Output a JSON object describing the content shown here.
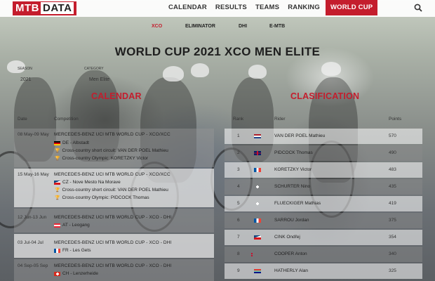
{
  "header": {
    "logo_mtb": "MTB",
    "logo_data": "DATA",
    "nav": [
      {
        "label": "CALENDAR"
      },
      {
        "label": "RESULTS"
      },
      {
        "label": "TEAMS"
      },
      {
        "label": "RANKING"
      },
      {
        "label": "WORLD CUP",
        "active": true
      }
    ],
    "search_icon": "search-icon"
  },
  "subnav": [
    {
      "label": "XCO",
      "active": true
    },
    {
      "label": "ELIMINATOR"
    },
    {
      "label": "DHI"
    },
    {
      "label": "E-MTB"
    }
  ],
  "page_title": "WORLD CUP 2021 XCO MEN ELITE",
  "filters": {
    "season_label": "SEASON",
    "season_value": "2021",
    "category_label": "CATEGORY",
    "category_value": "Men Elite"
  },
  "calendar": {
    "title": "CALENDAR",
    "col_date": "Date",
    "col_competition": "Competition",
    "rows": [
      {
        "date": "08 May-09 May",
        "competition": "MERCEDES-BENZ UCI MTB WORLD CUP - XCO/XCC",
        "location_flag": "DE",
        "location": "DE - Albstadt",
        "winners": [
          "Cross-country short circuit: VAN DER POEL Mathieu",
          "Cross-country Olympic: KORETZKY Victor"
        ]
      },
      {
        "date": "15 May-16 May",
        "competition": "MERCEDES-BENZ UCI MTB WORLD CUP - XCO/XCC",
        "location_flag": "CZ",
        "location": "CZ - Nove Mesto Na Morave",
        "winners": [
          "Cross-country short circuit: VAN DER POEL Mathieu",
          "Cross-country Olympic: PIDCOCK Thomas"
        ]
      },
      {
        "date": "12 Jun-13 Jun",
        "competition": "MERCEDES-BENZ UCI MTB WORLD CUP - XCO - DHI",
        "location_flag": "AT",
        "location": "AT - Leogang",
        "winners": []
      },
      {
        "date": "03 Jul-04 Jul",
        "competition": "MERCEDES-BENZ UCI MTB WORLD CUP - XCO - DHI",
        "location_flag": "FR",
        "location": "FR - Les Gets",
        "winners": []
      },
      {
        "date": "04 Sep-05 Sep",
        "competition": "MERCEDES-BENZ UCI MTB WORLD CUP - XCO - DHI",
        "location_flag": "CH",
        "location": "CH - Lenzerheide",
        "winners": []
      }
    ]
  },
  "classification": {
    "title": "CLASIFICATION",
    "col_rank": "Rank",
    "col_rider": "Rider",
    "col_points": "Points",
    "rows": [
      {
        "rank": "1",
        "flag": "NL",
        "rider": "VAN DER POEL Mathieu",
        "points": "570"
      },
      {
        "rank": "2",
        "flag": "GB",
        "rider": "PIDCOCK Thomas",
        "points": "490"
      },
      {
        "rank": "3",
        "flag": "FR",
        "rider": "KORETZKY Victor",
        "points": "483"
      },
      {
        "rank": "4",
        "flag": "CH",
        "rider": "SCHURTER Nino",
        "points": "435"
      },
      {
        "rank": "5",
        "flag": "CH",
        "rider": "FLUECKIGER Mathias",
        "points": "419"
      },
      {
        "rank": "6",
        "flag": "FR",
        "rider": "SARROU Jordan",
        "points": "375"
      },
      {
        "rank": "7",
        "flag": "CZ",
        "rider": "CINK Ondřej",
        "points": "354"
      },
      {
        "rank": "8",
        "flag": "NZ",
        "rider": "COOPER Anton",
        "points": "340"
      },
      {
        "rank": "9",
        "flag": "ZA",
        "rider": "HATHERLY Alan",
        "points": "325"
      }
    ]
  },
  "colors": {
    "accent": "#c41d2d"
  }
}
